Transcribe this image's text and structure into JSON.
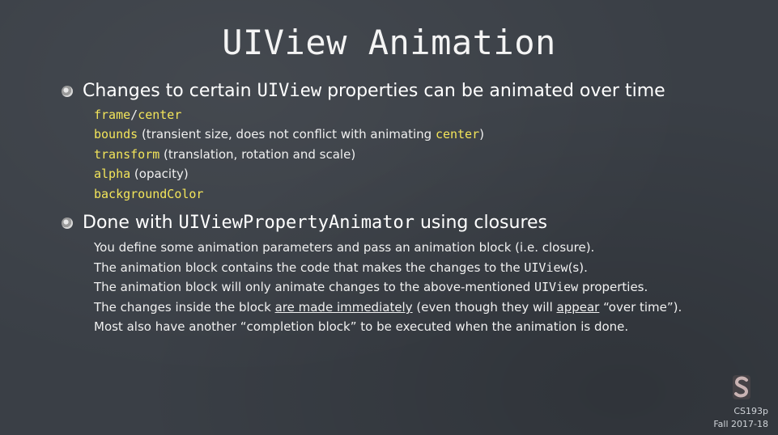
{
  "slide": {
    "title": "UIView Animation",
    "bullet1": {
      "prefix": "Changes to certain ",
      "code": "UIView",
      "suffix": " properties can be animated over time",
      "items": [
        {
          "a": "frame",
          "sep": "/",
          "b": "center"
        },
        {
          "code": "bounds",
          "text1": " (transient size, does not conflict with animating ",
          "code2": "center",
          "text2": ")"
        },
        {
          "code": "transform",
          "text": " (translation, rotation and scale)"
        },
        {
          "code": "alpha",
          "text": " (opacity)"
        },
        {
          "code": "backgroundColor"
        }
      ]
    },
    "bullet2": {
      "prefix": "Done with ",
      "code": "UIViewPropertyAnimator",
      "suffix": " using closures",
      "lines": {
        "l1": "You define some animation parameters and pass an animation block (i.e. closure).",
        "l2_pre": "The animation block contains the code that makes the changes to the ",
        "l2_code": "UIView",
        "l2_post": "(s).",
        "l3_pre": "The animation block will only animate changes to the above-mentioned ",
        "l3_code": "UIView",
        "l3_post": " properties.",
        "l4_pre": "The changes inside the block ",
        "l4_u1": "are made immediately",
        "l4_mid": " (even though they will ",
        "l4_u2": "appear",
        "l4_post": " “over time”).",
        "l5": "Most also have another “completion block” to be executed when the animation is done."
      }
    },
    "footer": {
      "course": "CS193p",
      "term": "Fall 2017-18",
      "logo_icon": "stanford-s-logo-icon"
    },
    "colors": {
      "background": "#3a3f46",
      "code_yellow": "#f3e55a"
    }
  }
}
